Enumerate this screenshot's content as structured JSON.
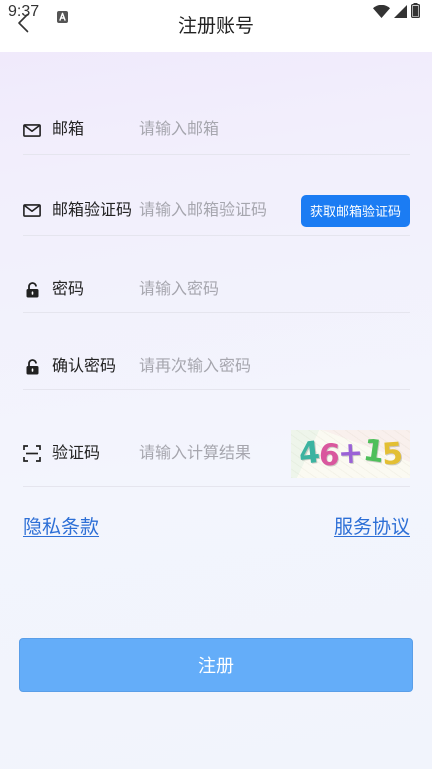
{
  "status_bar": {
    "time": "9:37",
    "notification_icon": "a-app-icon",
    "wifi_icon": "wifi-icon",
    "signal_icon": "signal-icon",
    "battery_icon": "battery-icon"
  },
  "header": {
    "back_icon": "chevron-left-icon",
    "title": "注册账号"
  },
  "form": {
    "fields": [
      {
        "icon": "mail-icon",
        "label": "邮箱",
        "placeholder": "请输入邮箱",
        "value": ""
      },
      {
        "icon": "mail-icon",
        "label": "邮箱验证码",
        "placeholder": "请输入邮箱验证码",
        "value": "",
        "action_label": "获取邮箱验证码"
      },
      {
        "icon": "lock-icon",
        "label": "密码",
        "placeholder": "请输入密码",
        "value": ""
      },
      {
        "icon": "lock-icon",
        "label": "确认密码",
        "placeholder": "请再次输入密码",
        "value": ""
      },
      {
        "icon": "scan-icon",
        "label": "验证码",
        "placeholder": "请输入计算结果",
        "value": ""
      }
    ],
    "captcha": {
      "text": "46+15",
      "colors": [
        "#3bb3a0",
        "#d9579e",
        "#9a62d6",
        "#4fbf5a",
        "#e3bf34"
      ]
    }
  },
  "links": {
    "privacy": "隐私条款",
    "terms": "服务协议"
  },
  "submit": {
    "label": "注册"
  },
  "colors": {
    "primary": "#1b7cf3",
    "submit_button": "#64adf9",
    "link": "#2d6fd6"
  }
}
